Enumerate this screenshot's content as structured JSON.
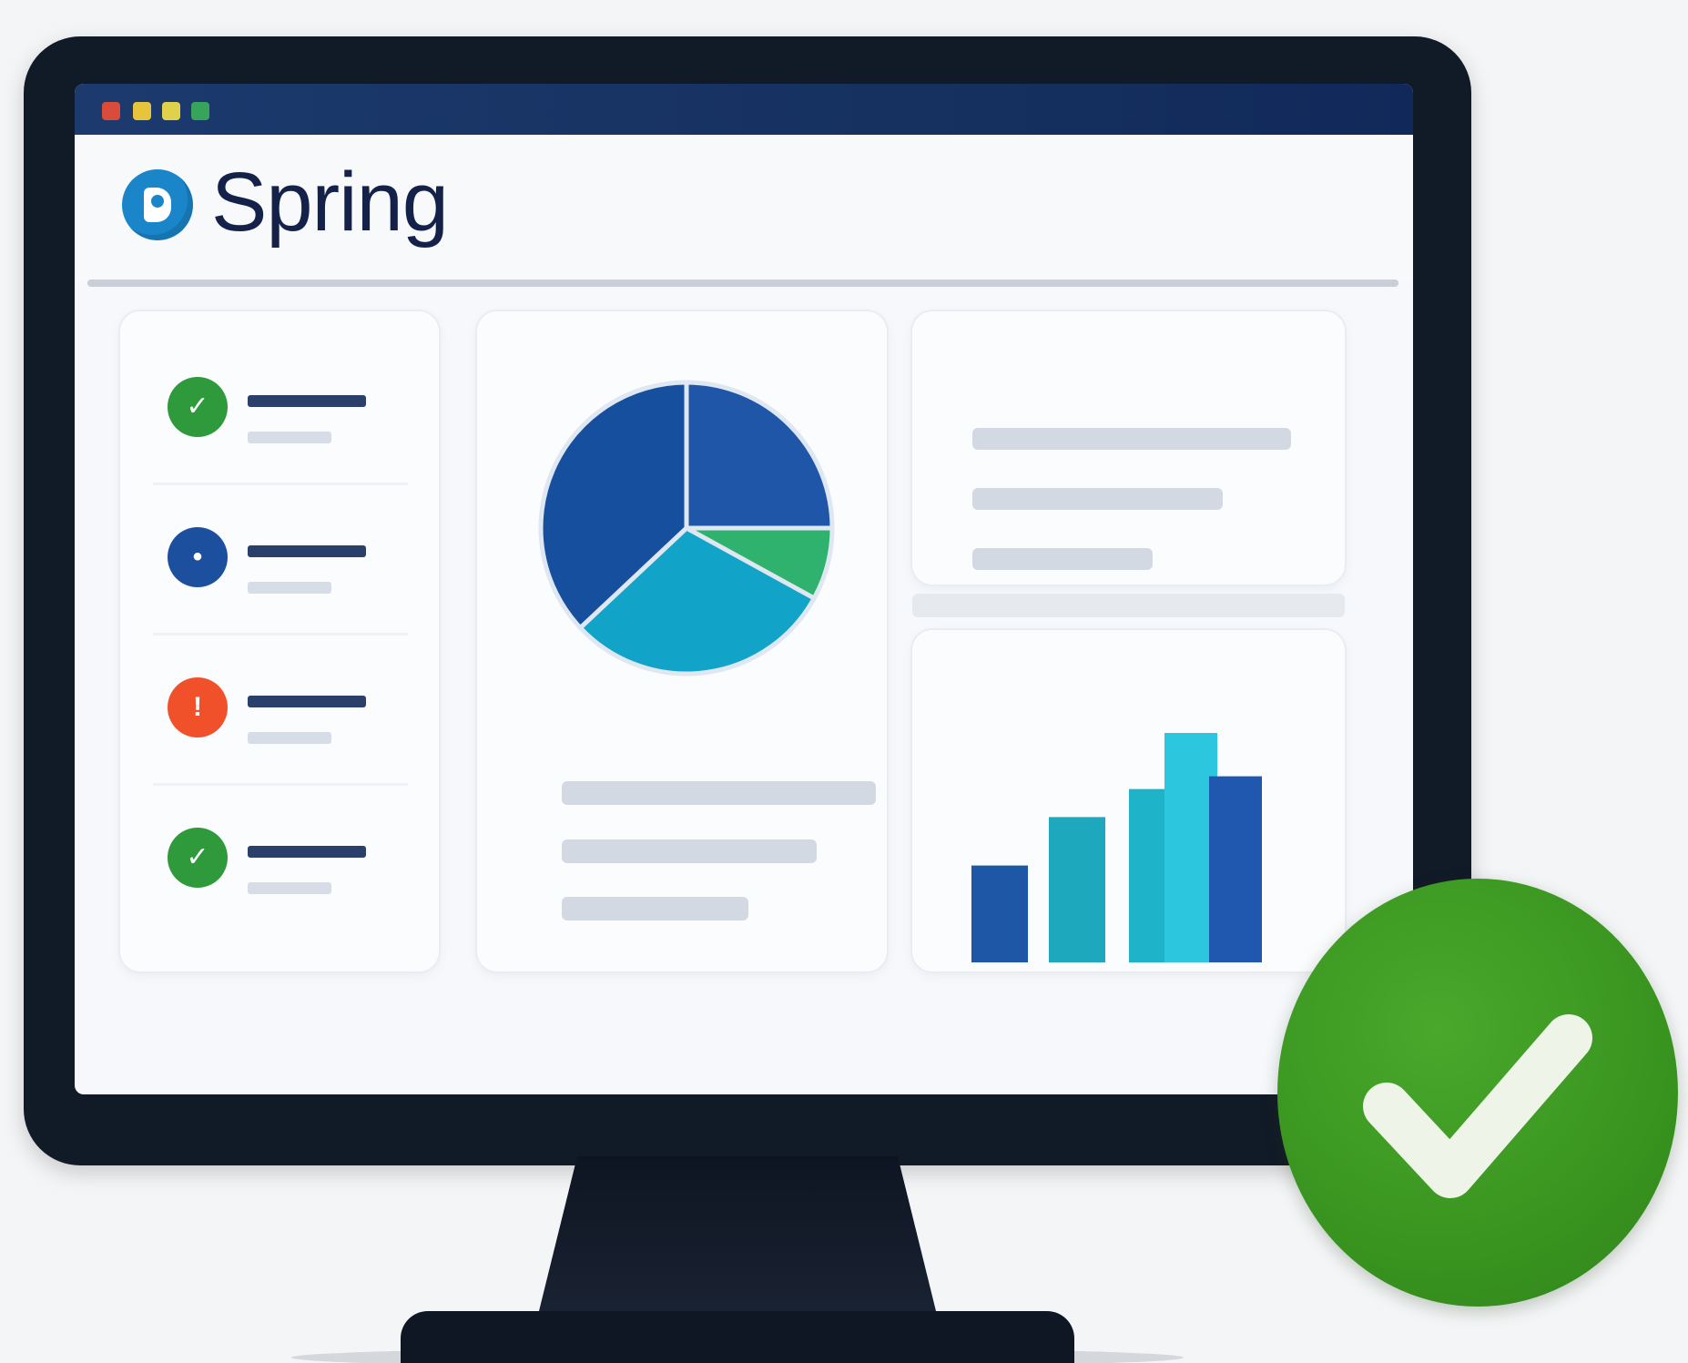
{
  "window": {
    "controls": [
      "close-dot",
      "minimize-dot",
      "zoom-dot",
      "extra-dot"
    ]
  },
  "header": {
    "brand": "Spring"
  },
  "status_list": {
    "items": [
      {
        "status": "success",
        "icon": "check-icon",
        "color": "#2f9a3b"
      },
      {
        "status": "info",
        "icon": "info-icon",
        "color": "#1d4f9f"
      },
      {
        "status": "warning",
        "icon": "alert-icon",
        "color": "#f0512a"
      },
      {
        "status": "success",
        "icon": "check-icon",
        "color": "#2f9a3b"
      }
    ]
  },
  "chart_data": [
    {
      "type": "pie",
      "title": "",
      "values": [
        25,
        8,
        30,
        37
      ],
      "colors": [
        "#1f56a8",
        "#2fb26e",
        "#12a3c9",
        "#174f9f"
      ]
    },
    {
      "type": "bar",
      "title": "",
      "categories": [
        "",
        "",
        "",
        "",
        ""
      ],
      "values": [
        38,
        57,
        68,
        90,
        73
      ],
      "colors": [
        "#1d57a5",
        "#1da8bd",
        "#1fb3c9",
        "#2cc7df",
        "#2058b0"
      ],
      "ylim": [
        0,
        100
      ]
    }
  ],
  "colors": {
    "accent": "#1a86c9",
    "title_bar": "#1c3a6e",
    "success": "#3a9620"
  },
  "badge": {
    "icon": "check-icon"
  }
}
